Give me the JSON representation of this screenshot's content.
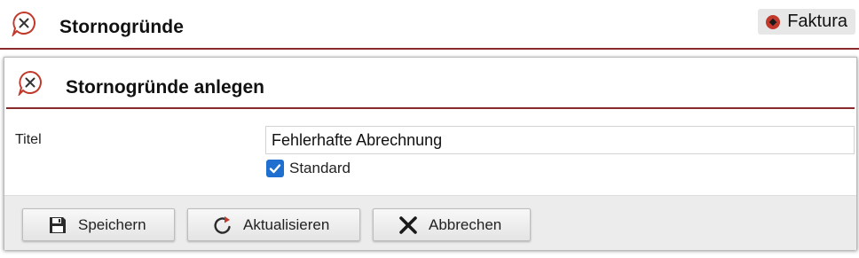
{
  "header": {
    "title": "Stornogründe",
    "icon": "cancel-speech-bubble-icon",
    "module_label": "Faktura",
    "module_icon": "diamond-dot-icon"
  },
  "dialog": {
    "title": "Stornogründe anlegen",
    "icon": "cancel-speech-bubble-icon",
    "fields": {
      "titel_label": "Titel",
      "titel_value": "Fehlerhafte Abrechnung",
      "standard_label": "Standard",
      "standard_checked": true
    },
    "buttons": {
      "save_label": "Speichern",
      "refresh_label": "Aktualisieren",
      "cancel_label": "Abbrechen"
    }
  },
  "colors": {
    "accent": "#8b2a2a",
    "checkbox": "#1f6fd0",
    "icon_red": "#c0392b"
  }
}
